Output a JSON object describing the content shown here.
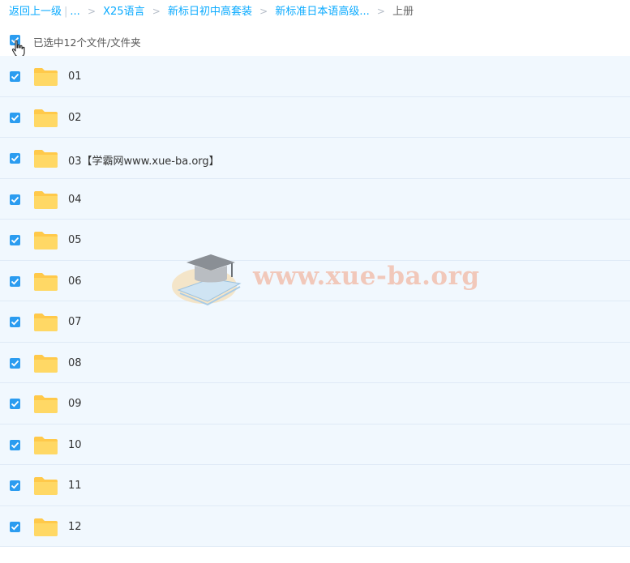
{
  "breadcrumb": {
    "back_label": "返回上一级",
    "pipe": "|",
    "ellipsis": "...",
    "sep": ">",
    "items": [
      "X25语言",
      "新标日初中高套装",
      "新标准日本语高级..."
    ],
    "current": "上册"
  },
  "selection": {
    "summary": "已选中12个文件/文件夹",
    "all_checked": true
  },
  "files": [
    {
      "name": "01",
      "checked": true
    },
    {
      "name": "02",
      "checked": true
    },
    {
      "name": "03【学霸网www.xue-ba.org】",
      "checked": true
    },
    {
      "name": "04",
      "checked": true
    },
    {
      "name": "05",
      "checked": true
    },
    {
      "name": "06",
      "checked": true
    },
    {
      "name": "07",
      "checked": true
    },
    {
      "name": "08",
      "checked": true
    },
    {
      "name": "09",
      "checked": true
    },
    {
      "name": "10",
      "checked": true
    },
    {
      "name": "11",
      "checked": true
    },
    {
      "name": "12",
      "checked": true
    }
  ],
  "watermark": {
    "text": "www.xue-ba.org"
  },
  "colors": {
    "accent": "#09aaff",
    "row_bg": "#f1f8fe",
    "folder": "#ffc94a",
    "check": "#2b9cf0"
  }
}
